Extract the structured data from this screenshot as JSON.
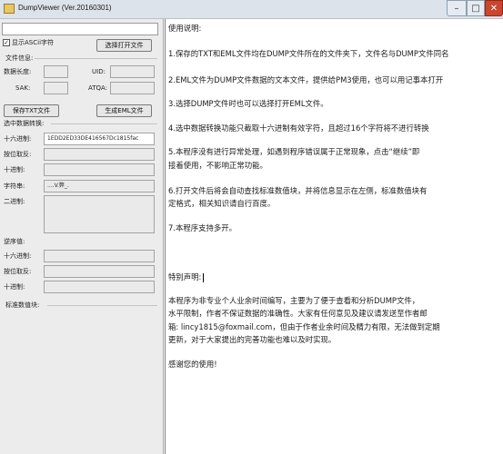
{
  "window": {
    "title": "DumpViewer (Ver.20160301)"
  },
  "left": {
    "show_ascii_label": "显示ASCii字符",
    "open_file_button": "选择打开文件",
    "file_info_label": "文件信息:",
    "data_length_label": "数据长度:",
    "uid_label": "UID:",
    "sak_label": "SAK:",
    "atqa_label": "ATQA:",
    "save_txt_button": "保存TXT文件",
    "gen_eml_button": "生成EML文件",
    "selected_convert_label": "选中数据转换:",
    "hex_label": "十六进制:",
    "hex_value": "1EDD2ED33DE416567Dc1815fac",
    "bit_invert_label": "按位取反:",
    "dec_label": "十进制:",
    "string_label": "字符串:",
    "string_value": "....V.弊_.",
    "binary_label": "二进制:",
    "inverse_label": "逆序值:",
    "inv_hex_label": "十六进制:",
    "inv_bit_label": "按位取反:",
    "inv_dec_label": "十进制:",
    "std_block_label": "标准数值块:"
  },
  "right": {
    "lines": [
      "使用说明:",
      "1.保存的TXT和EML文件均在DUMP文件所在的文件夹下，文件名与DUMP文件同名",
      "2.EML文件为DUMP文件数据的文本文件，提供给PM3使用，也可以用记事本打开",
      "3.选择DUMP文件时也可以选择打开EML文件。",
      "4.选中数据转换功能只截取十六进制有效字符，且超过16个字符将不进行转换",
      "5.本程序没有进行异常处理，如遇到程序错误属于正常现象，点击“继续”即",
      "接着使用，不影响正常功能。",
      "6.打开文件后将会自动查找标准数值块，并将信息显示在左侧，标准数值块有",
      "定格式，相关知识请自行百度。",
      "7.本程序支持多开。",
      "特别声明:",
      "        本程序为非专业个人业余时间编写，主要为了便于查看和分析DUMP文件，",
      "水平限制，作者不保证数据的准确性。大家有任何意见及建议请发送至作者邮",
      "箱: lincy1815@foxmail.com，但由于作者业余时间及精力有限，无法做到定期",
      "更新，对于大家提出的完善功能也难以及时实现。",
      "        感谢您的使用!"
    ]
  }
}
